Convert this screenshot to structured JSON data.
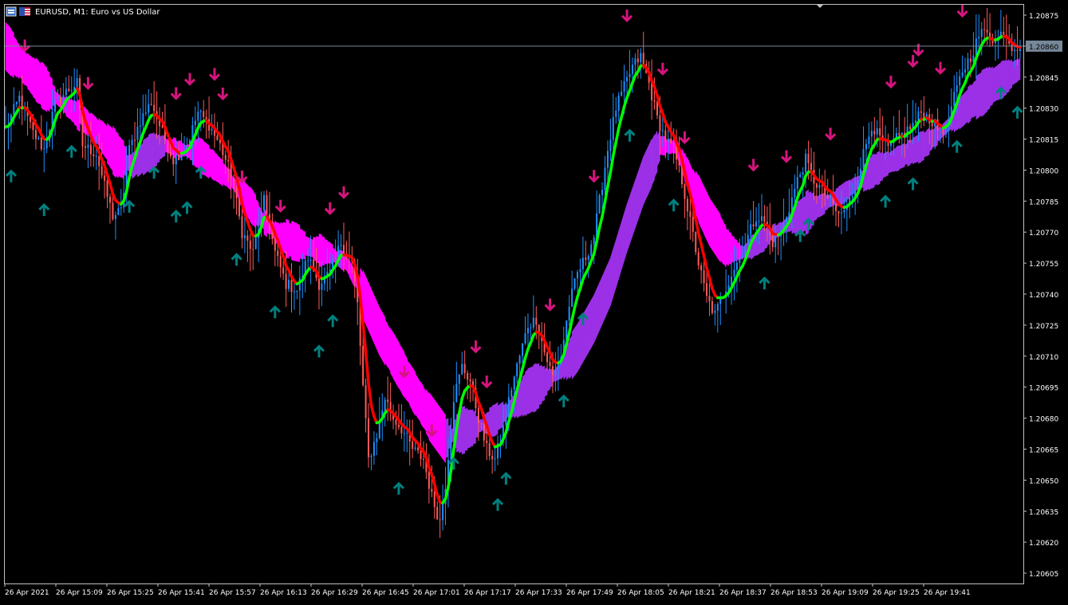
{
  "window": {
    "title": "EURUSD, M1:  Euro vs US Dollar"
  },
  "colors": {
    "background": "#000000",
    "axis": "#c0c0c0",
    "text": "#ffffff",
    "candle_up": "#1e90ff",
    "candle_down": "#ff5a5a",
    "signal_up": "#008080",
    "signal_down": "#d6147e",
    "ribbon_down": "#ff00ff",
    "ribbon_up": "#9b30e6",
    "fast_up": "#00ff00",
    "fast_down": "#ff0000",
    "bid_line": "#778899"
  },
  "chart_data": {
    "type": "candlestick",
    "symbol": "EURUSD",
    "timeframe": "M1",
    "ylim": [
      1.206,
      1.2088
    ],
    "y_ticks": [
      "1.20875",
      "1.20860",
      "1.20845",
      "1.20830",
      "1.20815",
      "1.20800",
      "1.20785",
      "1.20770",
      "1.20755",
      "1.20740",
      "1.20725",
      "1.20710",
      "1.20695",
      "1.20680",
      "1.20665",
      "1.20650",
      "1.20635",
      "1.20620",
      "1.20605"
    ],
    "current_price": "1.20860",
    "x_ticks": [
      "26 Apr 2021",
      "26 Apr 15:09",
      "26 Apr 15:25",
      "26 Apr 15:41",
      "26 Apr 15:57",
      "26 Apr 16:13",
      "26 Apr 16:29",
      "26 Apr 16:45",
      "26 Apr 17:01",
      "26 Apr 17:17",
      "26 Apr 17:33",
      "26 Apr 17:49",
      "26 Apr 18:05",
      "26 Apr 18:21",
      "26 Apr 18:37",
      "26 Apr 18:53",
      "26 Apr 19:09",
      "26 Apr 19:25",
      "26 Apr 19:41"
    ],
    "price_path": [
      [
        0,
        1.2082
      ],
      [
        5,
        1.20835
      ],
      [
        10,
        1.20818
      ],
      [
        14,
        1.2081
      ],
      [
        18,
        1.20832
      ],
      [
        22,
        1.20838
      ],
      [
        26,
        1.20842
      ],
      [
        28,
        1.20812
      ],
      [
        33,
        1.20808
      ],
      [
        36,
        1.20792
      ],
      [
        39,
        1.20778
      ],
      [
        42,
        1.2078
      ],
      [
        45,
        1.2081
      ],
      [
        49,
        1.20824
      ],
      [
        53,
        1.20833
      ],
      [
        57,
        1.20818
      ],
      [
        61,
        1.20805
      ],
      [
        66,
        1.20812
      ],
      [
        70,
        1.20828
      ],
      [
        74,
        1.20822
      ],
      [
        78,
        1.20812
      ],
      [
        82,
        1.20798
      ],
      [
        86,
        1.2077
      ],
      [
        90,
        1.2076
      ],
      [
        94,
        1.20785
      ],
      [
        98,
        1.2076
      ],
      [
        102,
        1.20745
      ],
      [
        106,
        1.20742
      ],
      [
        110,
        1.20758
      ],
      [
        114,
        1.20745
      ],
      [
        118,
        1.2075
      ],
      [
        122,
        1.20765
      ],
      [
        126,
        1.20755
      ],
      [
        128,
        1.20735
      ],
      [
        130,
        1.20695
      ],
      [
        132,
        1.2066
      ],
      [
        135,
        1.20672
      ],
      [
        138,
        1.2069
      ],
      [
        141,
        1.2068
      ],
      [
        144,
        1.20675
      ],
      [
        148,
        1.20665
      ],
      [
        152,
        1.2066
      ],
      [
        155,
        1.20642
      ],
      [
        158,
        1.2063
      ],
      [
        160,
        1.20648
      ],
      [
        163,
        1.2069
      ],
      [
        166,
        1.20705
      ],
      [
        169,
        1.20698
      ],
      [
        172,
        1.2068
      ],
      [
        175,
        1.20665
      ],
      [
        178,
        1.2066
      ],
      [
        181,
        1.20675
      ],
      [
        184,
        1.20695
      ],
      [
        187,
        1.2071
      ],
      [
        190,
        1.20725
      ],
      [
        193,
        1.20728
      ],
      [
        196,
        1.20712
      ],
      [
        199,
        1.207
      ],
      [
        202,
        1.2071
      ],
      [
        205,
        1.20735
      ],
      [
        208,
        1.2075
      ],
      [
        211,
        1.20758
      ],
      [
        214,
        1.20768
      ],
      [
        216,
        1.20785
      ],
      [
        219,
        1.2081
      ],
      [
        222,
        1.2083
      ],
      [
        225,
        1.2084
      ],
      [
        228,
        1.2085
      ],
      [
        231,
        1.20855
      ],
      [
        234,
        1.20842
      ],
      [
        237,
        1.20825
      ],
      [
        240,
        1.20815
      ],
      [
        243,
        1.2081
      ],
      [
        246,
        1.20795
      ],
      [
        249,
        1.20775
      ],
      [
        252,
        1.20755
      ],
      [
        255,
        1.20738
      ],
      [
        258,
        1.2073
      ],
      [
        261,
        1.2074
      ],
      [
        264,
        1.2075
      ],
      [
        267,
        1.20758
      ],
      [
        270,
        1.20768
      ],
      [
        273,
        1.20778
      ],
      [
        276,
        1.20775
      ],
      [
        279,
        1.20765
      ],
      [
        282,
        1.2077
      ],
      [
        285,
        1.20782
      ],
      [
        288,
        1.20795
      ],
      [
        291,
        1.20805
      ],
      [
        294,
        1.20795
      ],
      [
        297,
        1.2079
      ],
      [
        300,
        1.20785
      ],
      [
        303,
        1.20778
      ],
      [
        306,
        1.20782
      ],
      [
        309,
        1.20792
      ],
      [
        312,
        1.20808
      ],
      [
        315,
        1.20822
      ],
      [
        318,
        1.20815
      ],
      [
        321,
        1.2081
      ],
      [
        324,
        1.20815
      ],
      [
        327,
        1.20818
      ],
      [
        330,
        1.20822
      ],
      [
        333,
        1.20828
      ],
      [
        336,
        1.20825
      ],
      [
        339,
        1.2082
      ],
      [
        342,
        1.2082
      ],
      [
        345,
        1.20835
      ],
      [
        348,
        1.20848
      ],
      [
        351,
        1.20855
      ],
      [
        354,
        1.20865
      ],
      [
        357,
        1.20868
      ],
      [
        360,
        1.20862
      ],
      [
        363,
        1.20868
      ],
      [
        366,
        1.2086
      ],
      [
        369,
        1.2086
      ]
    ],
    "ribbon_path": [
      [
        0,
        1.2086
      ],
      [
        10,
        1.20845
      ],
      [
        20,
        1.20833
      ],
      [
        28,
        1.20825
      ],
      [
        34,
        1.20818
      ],
      [
        40,
        1.20808
      ],
      [
        46,
        1.20802
      ],
      [
        52,
        1.20808
      ],
      [
        58,
        1.20812
      ],
      [
        64,
        1.2081
      ],
      [
        70,
        1.20808
      ],
      [
        76,
        1.20802
      ],
      [
        82,
        1.20795
      ],
      [
        88,
        1.20785
      ],
      [
        94,
        1.20775
      ],
      [
        100,
        1.20768
      ],
      [
        106,
        1.20765
      ],
      [
        112,
        1.20762
      ],
      [
        118,
        1.2076
      ],
      [
        124,
        1.20755
      ],
      [
        130,
        1.2074
      ],
      [
        136,
        1.20722
      ],
      [
        142,
        1.20708
      ],
      [
        148,
        1.20694
      ],
      [
        154,
        1.20681
      ],
      [
        160,
        1.2067
      ],
      [
        166,
        1.20674
      ],
      [
        172,
        1.20676
      ],
      [
        178,
        1.20679
      ],
      [
        184,
        1.20685
      ],
      [
        190,
        1.20693
      ],
      [
        196,
        1.20697
      ],
      [
        202,
        1.20703
      ],
      [
        208,
        1.20714
      ],
      [
        214,
        1.20728
      ],
      [
        220,
        1.20746
      ],
      [
        226,
        1.20772
      ],
      [
        232,
        1.20795
      ],
      [
        238,
        1.20812
      ],
      [
        244,
        1.20811
      ],
      [
        250,
        1.20792
      ],
      [
        256,
        1.20775
      ],
      [
        262,
        1.20763
      ],
      [
        268,
        1.2076
      ],
      [
        274,
        1.20765
      ],
      [
        280,
        1.2077
      ],
      [
        286,
        1.20775
      ],
      [
        292,
        1.2078
      ],
      [
        298,
        1.20784
      ],
      [
        304,
        1.20788
      ],
      [
        310,
        1.20794
      ],
      [
        316,
        1.208
      ],
      [
        322,
        1.20804
      ],
      [
        328,
        1.20808
      ],
      [
        334,
        1.20812
      ],
      [
        340,
        1.20818
      ],
      [
        346,
        1.20826
      ],
      [
        352,
        1.20834
      ],
      [
        358,
        1.2084
      ],
      [
        364,
        1.20845
      ],
      [
        369,
        1.20849
      ]
    ],
    "signals_down": [
      7,
      30,
      62,
      67,
      76,
      79,
      86,
      100,
      118,
      123,
      145,
      155,
      171,
      175,
      198,
      214,
      226,
      239,
      247,
      272,
      284,
      300,
      322,
      330,
      332,
      340,
      348,
      363
    ],
    "signals_up": [
      2,
      14,
      24,
      45,
      54,
      62,
      66,
      71,
      84,
      98,
      114,
      119,
      143,
      163,
      179,
      182,
      203,
      210,
      227,
      243,
      276,
      289,
      292,
      320,
      330,
      346,
      362,
      368
    ]
  }
}
